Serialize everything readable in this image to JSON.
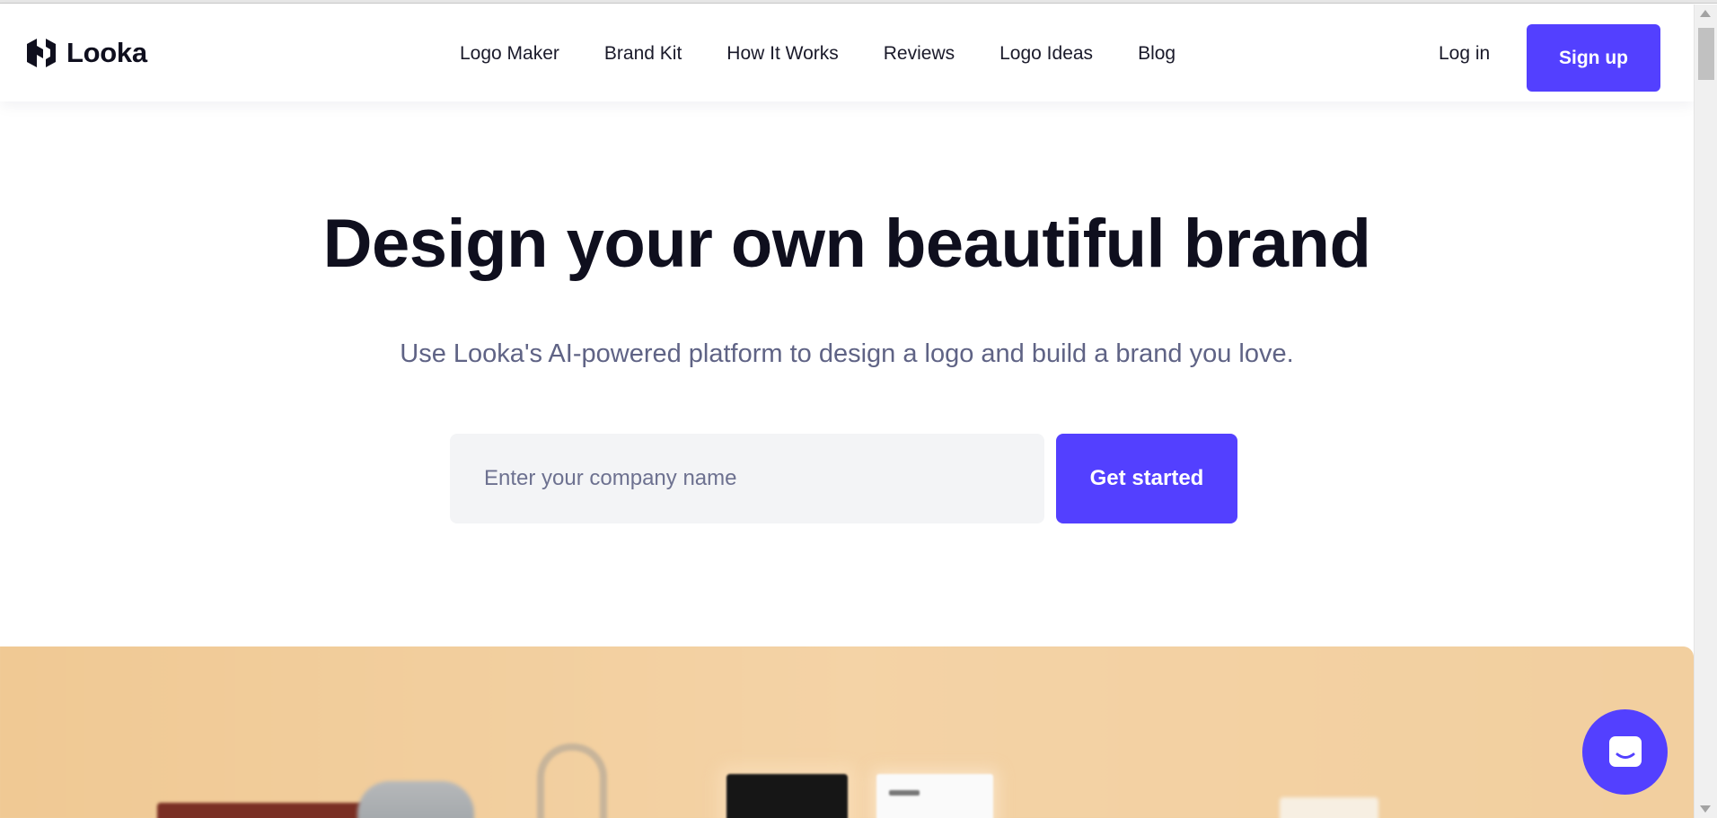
{
  "header": {
    "brand": "Looka",
    "nav": [
      {
        "label": "Logo Maker"
      },
      {
        "label": "Brand Kit"
      },
      {
        "label": "How It Works"
      },
      {
        "label": "Reviews"
      },
      {
        "label": "Logo Ideas"
      },
      {
        "label": "Blog"
      }
    ],
    "login_label": "Log in",
    "signup_label": "Sign up"
  },
  "hero": {
    "title": "Design your own beautiful brand",
    "subtitle": "Use Looka's AI-powered platform to design a logo and build a brand you love.",
    "input_placeholder": "Enter your company name",
    "input_value": "",
    "cta_label": "Get started"
  },
  "icons": {
    "logo": "looka-logo-icon",
    "chat": "chat-icon"
  },
  "colors": {
    "accent": "#5340ff",
    "heading": "#0f0f1e",
    "subtitle": "#5f6385",
    "input_bg": "#f3f4f6",
    "showcase_bg": "#f1cc9a"
  }
}
